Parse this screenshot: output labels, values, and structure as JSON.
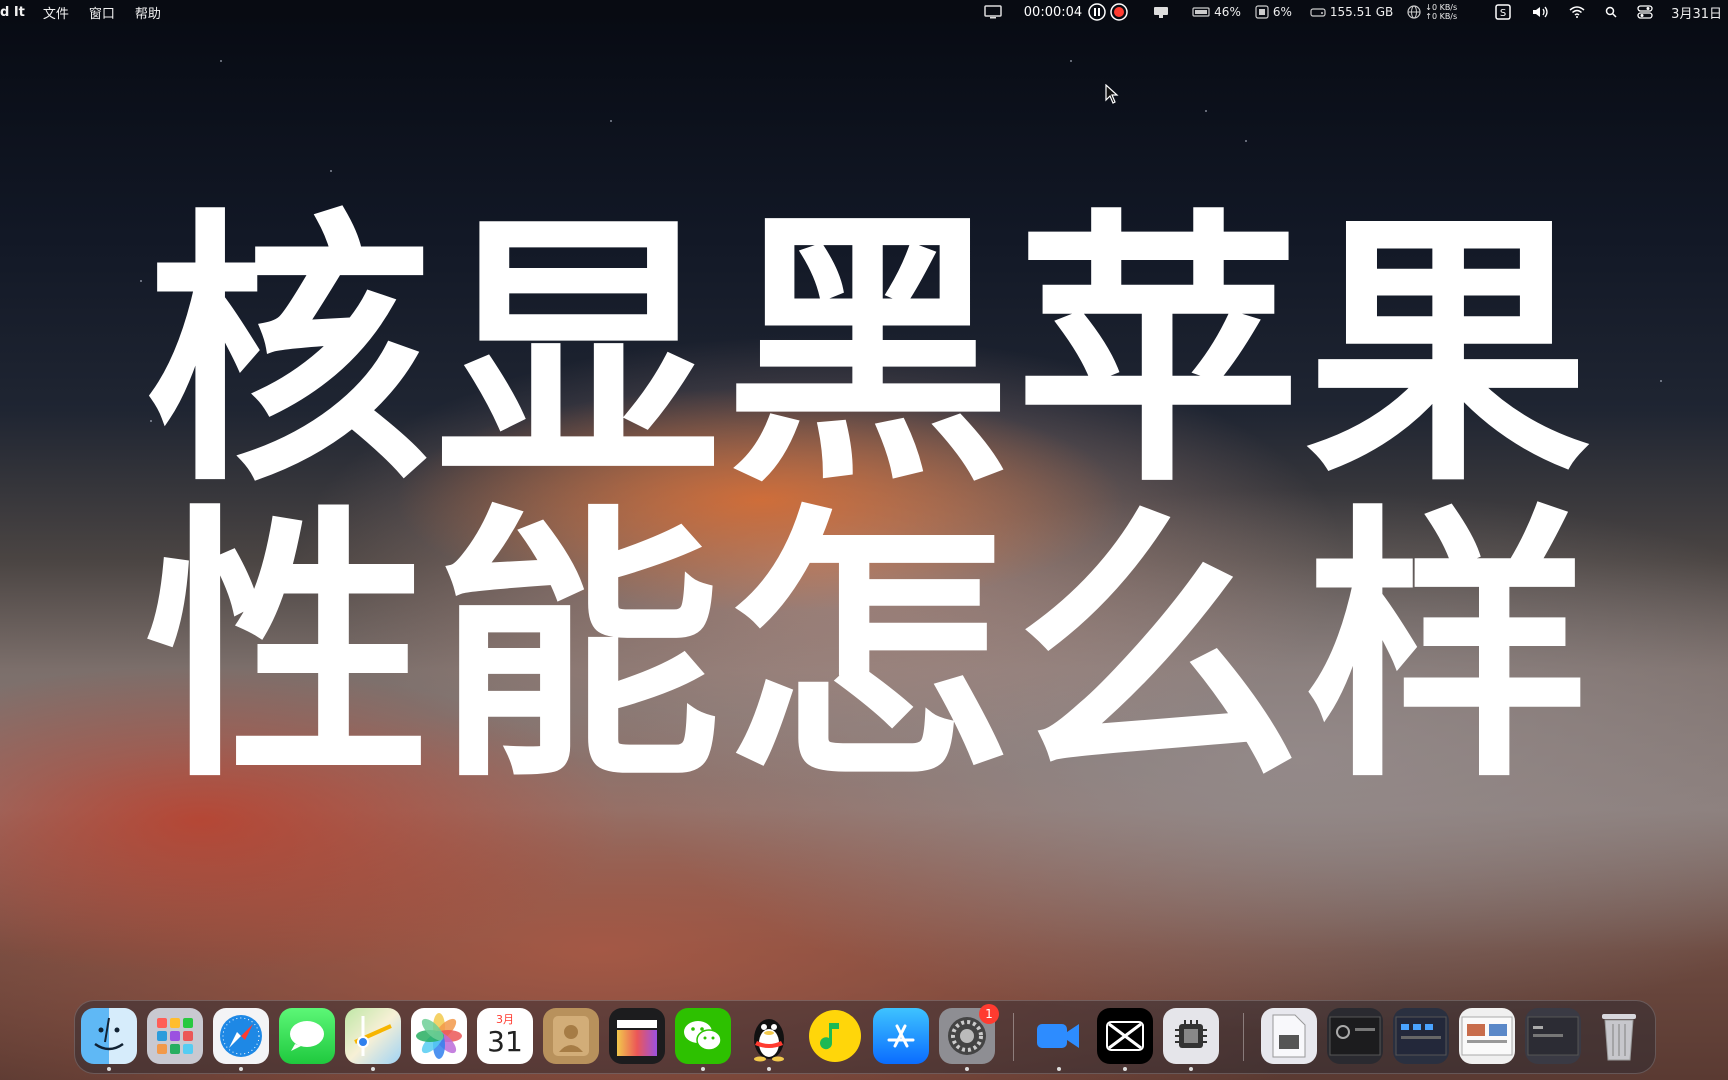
{
  "menubar": {
    "app_name": "d It",
    "menus": [
      "文件",
      "窗口",
      "帮助"
    ],
    "timer": "00:00:04",
    "battery": "46%",
    "cpu": "6%",
    "disk": "155.51 GB",
    "net_up": "↓0 KB/s",
    "net_down": "↑0 KB/s",
    "date": "3月31日"
  },
  "headline": {
    "line1": "核显黑苹果",
    "line2": "性能怎么样"
  },
  "dock": {
    "calendar_month": "3月",
    "calendar_day": "31",
    "settings_badge": "1"
  }
}
